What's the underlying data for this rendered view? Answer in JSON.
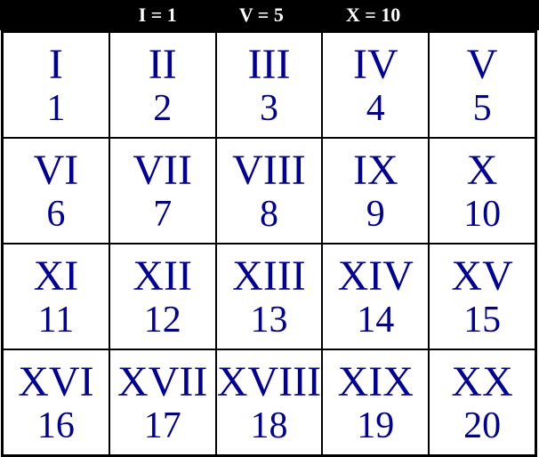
{
  "legend": [
    {
      "text": "I = 1"
    },
    {
      "text": "V = 5"
    },
    {
      "text": "X = 10"
    }
  ],
  "cells": [
    {
      "roman": "I",
      "arabic": "1"
    },
    {
      "roman": "II",
      "arabic": "2"
    },
    {
      "roman": "III",
      "arabic": "3"
    },
    {
      "roman": "IV",
      "arabic": "4"
    },
    {
      "roman": "V",
      "arabic": "5"
    },
    {
      "roman": "VI",
      "arabic": "6"
    },
    {
      "roman": "VII",
      "arabic": "7"
    },
    {
      "roman": "VIII",
      "arabic": "8"
    },
    {
      "roman": "IX",
      "arabic": "9"
    },
    {
      "roman": "X",
      "arabic": "10"
    },
    {
      "roman": "XI",
      "arabic": "11"
    },
    {
      "roman": "XII",
      "arabic": "12"
    },
    {
      "roman": "XIII",
      "arabic": "13"
    },
    {
      "roman": "XIV",
      "arabic": "14"
    },
    {
      "roman": "XV",
      "arabic": "15"
    },
    {
      "roman": "XVI",
      "arabic": "16"
    },
    {
      "roman": "XVII",
      "arabic": "17"
    },
    {
      "roman": "XVIII",
      "arabic": "18"
    },
    {
      "roman": "XIX",
      "arabic": "19"
    },
    {
      "roman": "XX",
      "arabic": "20"
    }
  ]
}
